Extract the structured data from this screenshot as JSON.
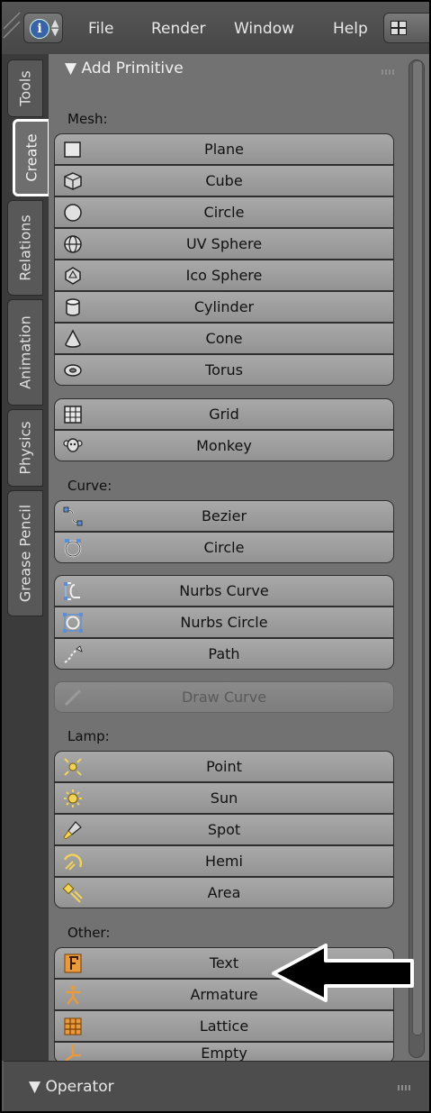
{
  "menubar": {
    "items": [
      "File",
      "Render",
      "Window",
      "Help"
    ]
  },
  "tabs": [
    "Tools",
    "Create",
    "Relations",
    "Animation",
    "Physics",
    "Grease Pencil"
  ],
  "active_tab": "Create",
  "panel": {
    "title": "Add Primitive",
    "sections": {
      "mesh": "Mesh:",
      "curve": "Curve:",
      "lamp": "Lamp:",
      "other": "Other:"
    },
    "mesh": [
      "Plane",
      "Cube",
      "Circle",
      "UV Sphere",
      "Ico Sphere",
      "Cylinder",
      "Cone",
      "Torus"
    ],
    "mesh2": [
      "Grid",
      "Monkey"
    ],
    "curve": [
      "Bezier",
      "Circle"
    ],
    "curve2": [
      "Nurbs Curve",
      "Nurbs Circle",
      "Path"
    ],
    "draw_curve": "Draw Curve",
    "lamp": [
      "Point",
      "Sun",
      "Spot",
      "Hemi",
      "Area"
    ],
    "other": [
      "Text",
      "Armature",
      "Lattice",
      "Empty"
    ]
  },
  "operator": {
    "title": "Operator"
  }
}
